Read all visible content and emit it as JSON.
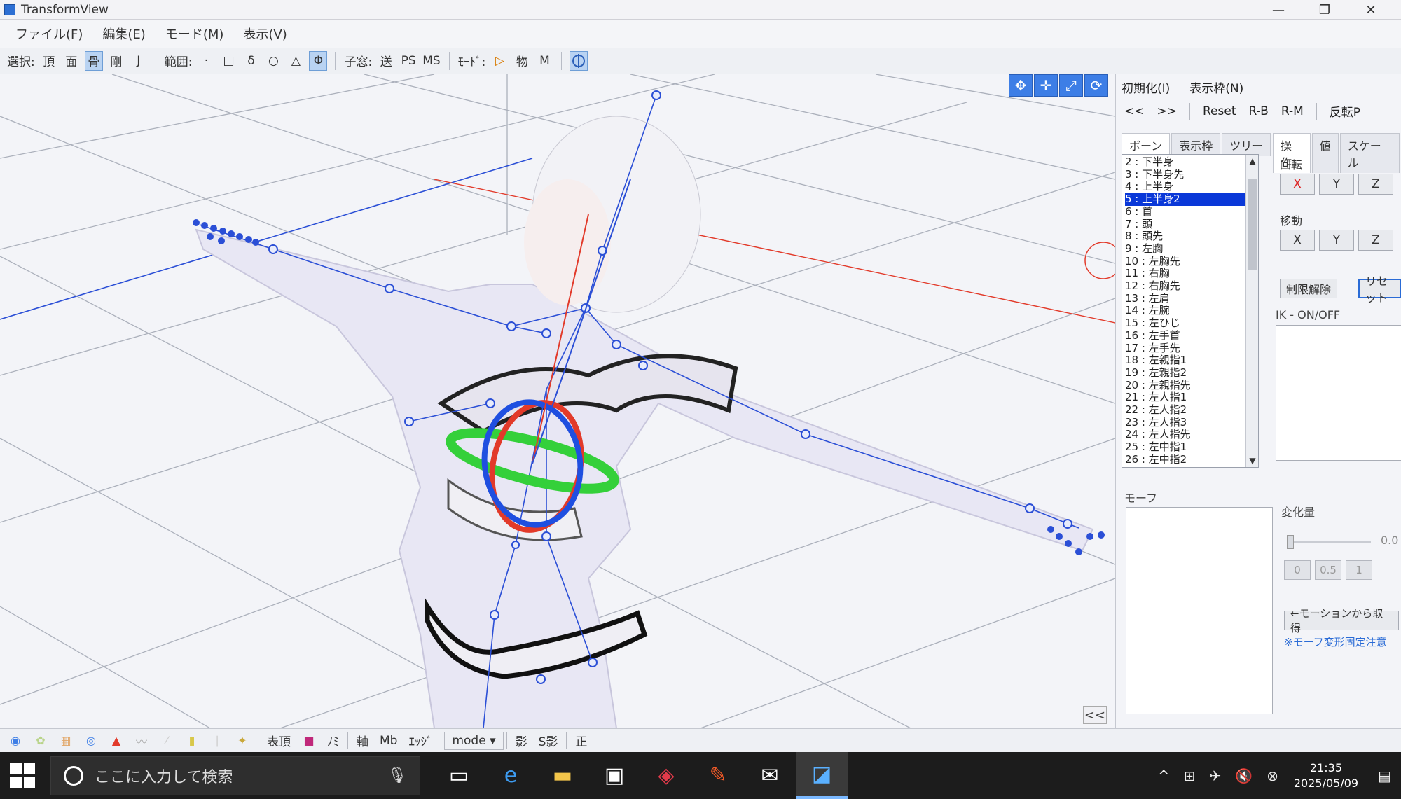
{
  "window": {
    "title": "TransformView",
    "min": "—",
    "restore": "❐",
    "close": "✕"
  },
  "menu": [
    "ファイル(F)",
    "編集(E)",
    "モード(M)",
    "表示(V)"
  ],
  "toolbar": {
    "select_label": "選択:",
    "select_btns": [
      "頂",
      "面",
      "骨",
      "剛",
      "J"
    ],
    "range_label": "範囲:",
    "range_btns": [
      "·",
      "□",
      "δ",
      "○",
      "△",
      "Φ"
    ],
    "child_label": "子窓:",
    "child_btns": [
      "送",
      "PS",
      "MS"
    ],
    "mode_label": "ﾓｰﾄﾞ:",
    "mode_btns": [
      "▷",
      "物",
      "M"
    ]
  },
  "right_panel": {
    "init_label": "初期化(I)",
    "frame_label": "表示枠(N)",
    "prev": "<<",
    "next": ">>",
    "reset": "Reset",
    "rb": "R-B",
    "rm": "R-M",
    "flip": "反転P",
    "list_tabs": [
      "ボーン",
      "表示枠",
      "ツリー"
    ],
    "op_tabs": [
      "操作",
      "値",
      "スケール"
    ],
    "bones": [
      "2 : 下半身",
      "3 : 下半身先",
      "4 : 上半身",
      "5 : 上半身2",
      "6 : 首",
      "7 : 頭",
      "8 : 頭先",
      "9 : 左胸",
      "10 : 左胸先",
      "11 : 右胸",
      "12 : 右胸先",
      "13 : 左肩",
      "14 : 左腕",
      "15 : 左ひじ",
      "16 : 左手首",
      "17 : 左手先",
      "18 : 左親指1",
      "19 : 左親指2",
      "20 : 左親指先",
      "21 : 左人指1",
      "22 : 左人指2",
      "23 : 左人指3",
      "24 : 左人指先",
      "25 : 左中指1",
      "26 : 左中指2"
    ],
    "selected_bone_index": 3,
    "rotate_label": "回転",
    "move_label": "移動",
    "axes": [
      "X",
      "Y",
      "Z"
    ],
    "limit_release": "制限解除",
    "reset_jp": "リセット",
    "ik_label": "IK - ON/OFF",
    "morph_label": "モーフ",
    "change_label": "変化量",
    "change_value": "0.0",
    "morph_vals": [
      "0",
      "0.5",
      "1"
    ],
    "from_motion": "←モーションから取得",
    "morph_note": "※モーフ変形固定注意",
    "collapse": "<<"
  },
  "bottom_toolbar": {
    "front_label": "表頂",
    "mi_label": "ﾉﾐ",
    "axis_label": "軸",
    "mb_label": "Mb",
    "edge_label": "ｴｯｼﾞ",
    "mode_select": "mode",
    "shadow": "影",
    "sshadow": "S影",
    "correct": "正"
  },
  "taskbar": {
    "search_placeholder": "ここに入力して検索",
    "time": "21:35",
    "date": "2025/05/09"
  },
  "colors": {
    "accent": "#3d7ee6",
    "selected": "#0a38d8",
    "bone": "#2b4fd6",
    "gizmo_red": "#e23a2a",
    "gizmo_blue": "#1f4fe0",
    "gizmo_green": "#34d03a"
  }
}
